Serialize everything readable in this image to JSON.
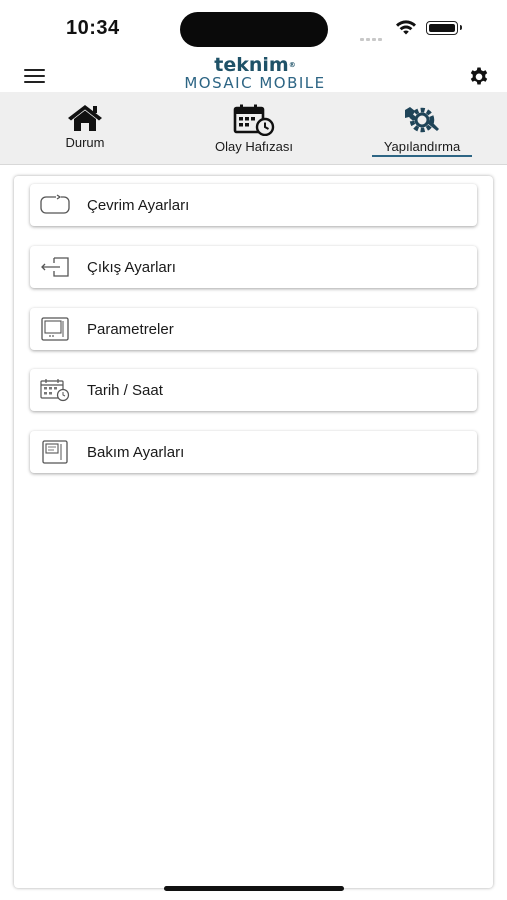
{
  "status_bar": {
    "time": "10:34"
  },
  "header": {
    "brand_top": "teknim",
    "brand_mark": "®",
    "brand_bottom": "MOSAIC MOBILE"
  },
  "tabs": [
    {
      "label": "Durum",
      "icon": "home-icon",
      "active": false
    },
    {
      "label": "Olay Hafızası",
      "icon": "calendar-clock-icon",
      "active": false
    },
    {
      "label": "Yapılandırma",
      "icon": "wrench-gear-icon",
      "active": true
    }
  ],
  "menu_items": [
    {
      "label": "Çevrim Ayarları",
      "icon": "cycle-icon"
    },
    {
      "label": "Çıkış Ayarları",
      "icon": "exit-icon"
    },
    {
      "label": "Parametreler",
      "icon": "device-parameters-icon"
    },
    {
      "label": "Tarih / Saat",
      "icon": "calendar-clock-icon"
    },
    {
      "label": "Bakım Ayarları",
      "icon": "maintenance-panel-icon"
    }
  ],
  "colors": {
    "accent": "#2d6584",
    "tabbar_bg": "#efefef"
  }
}
